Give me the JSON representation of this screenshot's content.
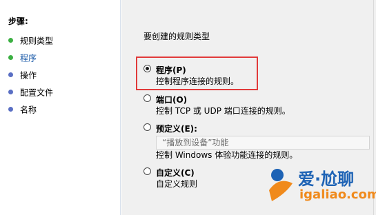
{
  "steps": {
    "title": "步骤:",
    "items": [
      {
        "label": "规则类型",
        "dot_color": "#3cb043"
      },
      {
        "label": "程序",
        "dot_color": "#3cb043"
      },
      {
        "label": "操作",
        "dot_color": "#5a6fc4"
      },
      {
        "label": "配置文件",
        "dot_color": "#5a6fc4"
      },
      {
        "label": "名称",
        "dot_color": "#5a6fc4"
      }
    ]
  },
  "main": {
    "heading": "要创建的规则类型",
    "options": [
      {
        "title": "程序(P)",
        "desc": "控制程序连接的规则。",
        "checked": true
      },
      {
        "title": "端口(O)",
        "desc": "控制 TCP 或 UDP 端口连接的规则。",
        "checked": false
      },
      {
        "title": "预定义(E):",
        "desc": "控制 Windows 体验功能连接的规则。",
        "checked": false,
        "combo_value": "“播放到设备”功能"
      },
      {
        "title": "自定义(C)",
        "desc": "自定义规则",
        "checked": false
      }
    ]
  },
  "watermark": {
    "text": "爱·尬聊",
    "url": "igaliao.com"
  },
  "colors": {
    "highlight": "#e13a3a",
    "active_step": "#1a5aa8"
  }
}
